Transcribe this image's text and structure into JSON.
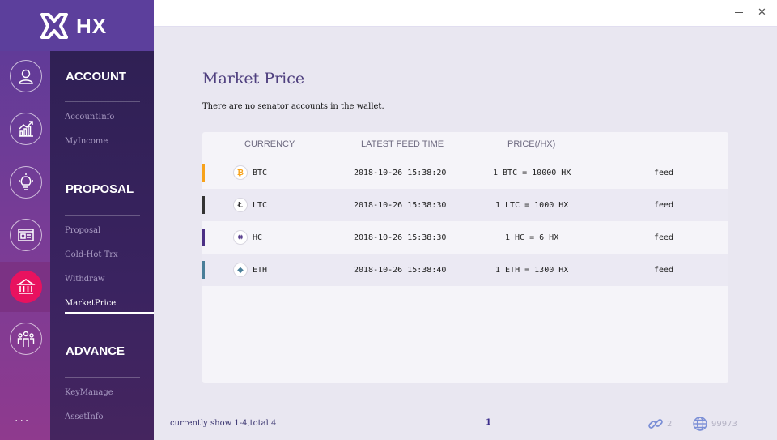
{
  "app": {
    "logo_text": "HX"
  },
  "window": {
    "minimize_glyph": "—",
    "close_glyph": "✕"
  },
  "rail": {
    "items": [
      {
        "icon": "user-icon"
      },
      {
        "icon": "chart-icon"
      },
      {
        "icon": "bulb-icon"
      },
      {
        "icon": "card-icon"
      },
      {
        "icon": "bank-icon",
        "active": true
      },
      {
        "icon": "group-icon"
      }
    ],
    "more": "..."
  },
  "menu": {
    "account": {
      "title": "ACCOUNT",
      "items": [
        "AccountInfo",
        "MyIncome"
      ]
    },
    "proposal": {
      "title": "PROPOSAL",
      "items": [
        "Proposal",
        "Cold-Hot Trx",
        "Withdraw",
        "MarketPrice"
      ]
    },
    "advance": {
      "title": "ADVANCE",
      "items": [
        "KeyManage",
        "AssetInfo"
      ]
    },
    "active_item": "MarketPrice"
  },
  "main": {
    "title": "Market Price",
    "notice": "There are no senator accounts in the wallet."
  },
  "table": {
    "headers": [
      "CURRENCY",
      "LATEST FEED TIME",
      "PRICE(/HX)"
    ],
    "rows": [
      {
        "symbol": "BTC",
        "icon": "bitcoin-icon",
        "glyph": "₿",
        "color": "#f7a21b",
        "time": "2018-10-26 15:38:20",
        "price": "1 BTC = 10000 HX",
        "action": "feed"
      },
      {
        "symbol": "LTC",
        "icon": "litecoin-icon",
        "glyph": "Ł",
        "color": "#333333",
        "time": "2018-10-26 15:38:30",
        "price": "1 LTC = 1000 HX",
        "action": "feed"
      },
      {
        "symbol": "HC",
        "icon": "hcash-icon",
        "glyph": "⌗",
        "color": "#4b2f85",
        "time": "2018-10-26 15:38:30",
        "price": "1 HC = 6 HX",
        "action": "feed"
      },
      {
        "symbol": "ETH",
        "icon": "ethereum-icon",
        "glyph": "◆",
        "color": "#4a7f99",
        "time": "2018-10-26 15:38:40",
        "price": "1 ETH = 1300 HX",
        "action": "feed"
      }
    ]
  },
  "footer": {
    "info": "currently show 1-4,total 4",
    "page": "1",
    "connections": "2",
    "block_height": "99973"
  }
}
